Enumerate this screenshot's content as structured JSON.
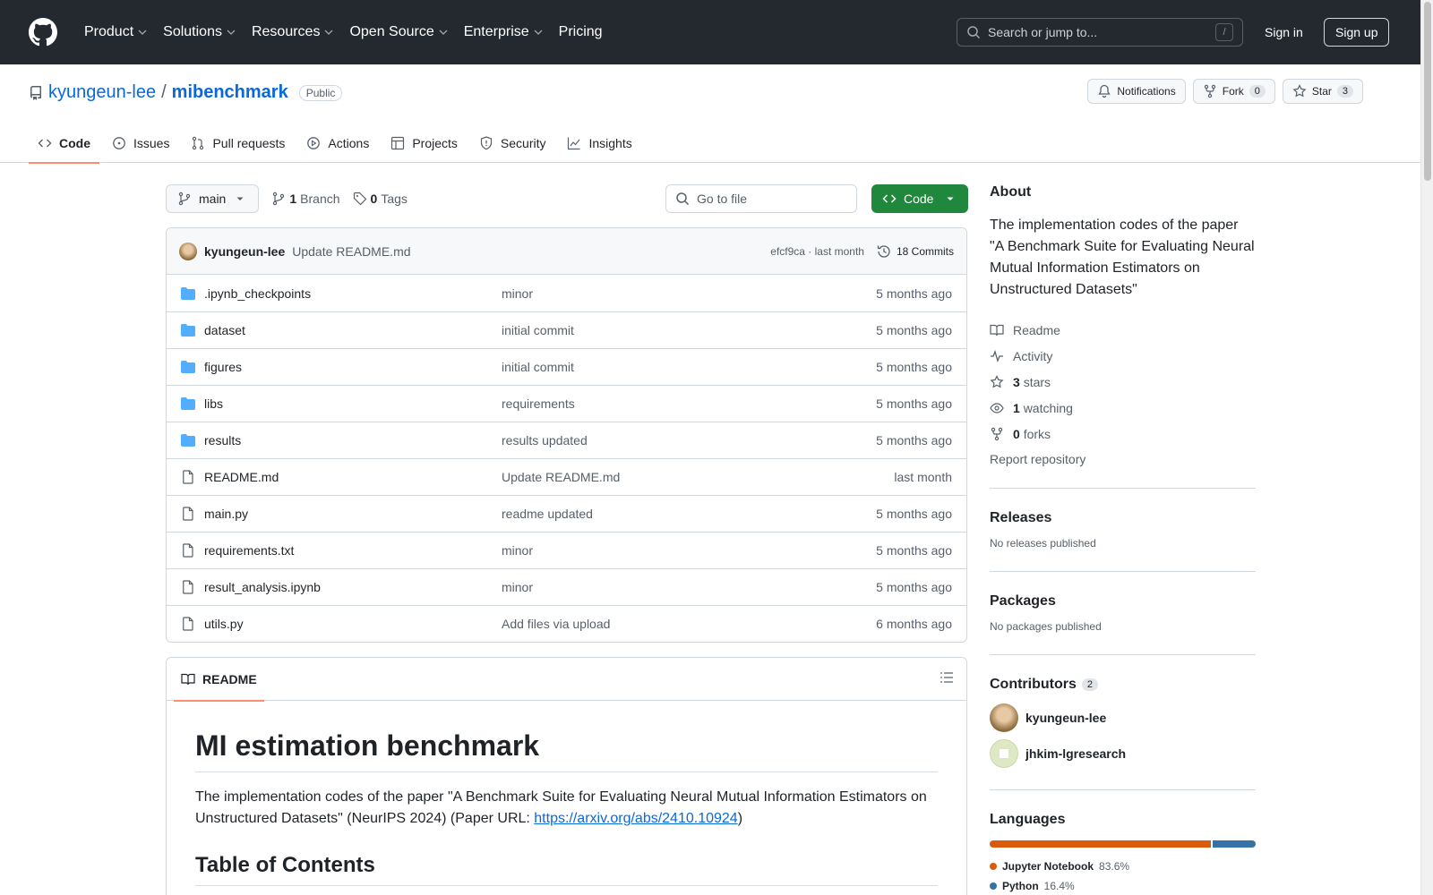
{
  "header": {
    "nav": [
      {
        "label": "Product",
        "has_menu": true
      },
      {
        "label": "Solutions",
        "has_menu": true
      },
      {
        "label": "Resources",
        "has_menu": true
      },
      {
        "label": "Open Source",
        "has_menu": true
      },
      {
        "label": "Enterprise",
        "has_menu": true
      },
      {
        "label": "Pricing",
        "has_menu": false
      }
    ],
    "search_placeholder": "Search or jump to...",
    "search_shortcut": "/",
    "sign_in": "Sign in",
    "sign_up": "Sign up"
  },
  "repo": {
    "owner": "kyungeun-lee",
    "separator": "/",
    "name": "mibenchmark",
    "visibility": "Public",
    "actions": {
      "notifications": "Notifications",
      "fork": "Fork",
      "fork_count": "0",
      "star": "Star",
      "star_count": "3"
    },
    "tabs": [
      {
        "label": "Code",
        "icon": "code-icon",
        "active": true
      },
      {
        "label": "Issues",
        "icon": "issue-icon",
        "active": false
      },
      {
        "label": "Pull requests",
        "icon": "pull-request-icon",
        "active": false
      },
      {
        "label": "Actions",
        "icon": "play-icon",
        "active": false
      },
      {
        "label": "Projects",
        "icon": "table-icon",
        "active": false
      },
      {
        "label": "Security",
        "icon": "shield-icon",
        "active": false
      },
      {
        "label": "Insights",
        "icon": "graph-icon",
        "active": false
      }
    ]
  },
  "toolbar": {
    "branch": "main",
    "branch_count": "1",
    "branch_label": "Branch",
    "tag_count": "0",
    "tag_label": "Tags",
    "goto_placeholder": "Go to file",
    "code_button": "Code"
  },
  "latest_commit": {
    "author": "kyungeun-lee",
    "message": "Update README.md",
    "hash_time": "efcf9ca · last month",
    "commits": "18 Commits"
  },
  "files": [
    {
      "name": ".ipynb_checkpoints",
      "type": "folder",
      "message": "minor",
      "age": "5 months ago"
    },
    {
      "name": "dataset",
      "type": "folder",
      "message": "initial commit",
      "age": "5 months ago"
    },
    {
      "name": "figures",
      "type": "folder",
      "message": "initial commit",
      "age": "5 months ago"
    },
    {
      "name": "libs",
      "type": "folder",
      "message": "requirements",
      "age": "5 months ago"
    },
    {
      "name": "results",
      "type": "folder",
      "message": "results updated",
      "age": "5 months ago"
    },
    {
      "name": "README.md",
      "type": "file",
      "message": "Update README.md",
      "age": "last month"
    },
    {
      "name": "main.py",
      "type": "file",
      "message": "readme updated",
      "age": "5 months ago"
    },
    {
      "name": "requirements.txt",
      "type": "file",
      "message": "minor",
      "age": "5 months ago"
    },
    {
      "name": "result_analysis.ipynb",
      "type": "file",
      "message": "minor",
      "age": "5 months ago"
    },
    {
      "name": "utils.py",
      "type": "file",
      "message": "Add files via upload",
      "age": "6 months ago"
    }
  ],
  "readme": {
    "tab_label": "README",
    "title": "MI estimation benchmark",
    "paragraph": "The implementation codes of the paper \"A Benchmark Suite for Evaluating Neural Mutual Information Estimators on Unstructured Datasets\" (NeurIPS 2024) (Paper URL: ",
    "link": "https://arxiv.org/abs/2410.10924",
    "paragraph_end": ")",
    "toc_heading": "Table of Contents"
  },
  "sidebar": {
    "about_title": "About",
    "description": "The implementation codes of the paper \"A Benchmark Suite for Evaluating Neural Mutual Information Estimators on Unstructured Datasets\"",
    "links": [
      {
        "icon": "book-icon",
        "bold": "",
        "label": "Readme"
      },
      {
        "icon": "pulse-icon",
        "bold": "",
        "label": "Activity"
      },
      {
        "icon": "star-icon",
        "bold": "3",
        "label": "stars"
      },
      {
        "icon": "eye-icon",
        "bold": "1",
        "label": "watching"
      },
      {
        "icon": "fork-icon",
        "bold": "0",
        "label": "forks"
      }
    ],
    "report": "Report repository",
    "releases_title": "Releases",
    "releases_text": "No releases published",
    "packages_title": "Packages",
    "packages_text": "No packages published",
    "contributors_title": "Contributors",
    "contributors_count": "2",
    "contributors": [
      {
        "name": "kyungeun-lee"
      },
      {
        "name": "jhkim-lgresearch"
      }
    ],
    "languages_title": "Languages",
    "languages": [
      {
        "name": "Jupyter Notebook",
        "percent": "83.6%",
        "value": 83.6,
        "color": "#DA5B0B"
      },
      {
        "name": "Python",
        "percent": "16.4%",
        "value": 16.4,
        "color": "#3572A5"
      }
    ]
  }
}
